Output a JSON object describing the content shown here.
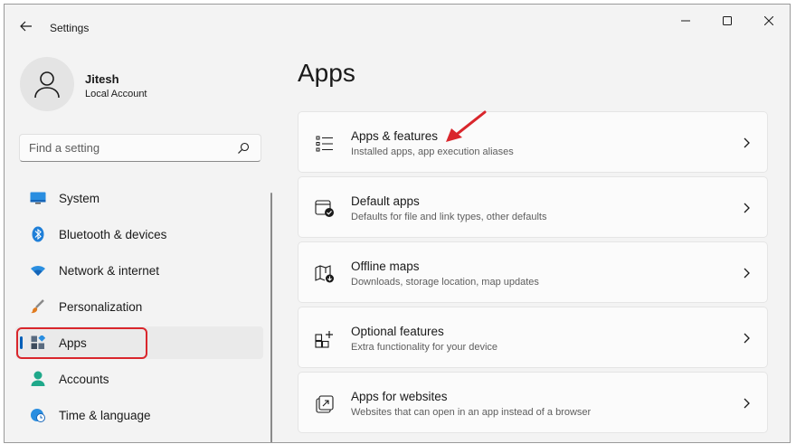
{
  "window": {
    "title": "Settings"
  },
  "account": {
    "name": "Jitesh",
    "type": "Local Account"
  },
  "search": {
    "placeholder": "Find a setting"
  },
  "nav": {
    "items": [
      {
        "label": "System",
        "icon": "monitor-icon"
      },
      {
        "label": "Bluetooth & devices",
        "icon": "bluetooth-icon"
      },
      {
        "label": "Network & internet",
        "icon": "wifi-icon"
      },
      {
        "label": "Personalization",
        "icon": "brush-icon"
      },
      {
        "label": "Apps",
        "icon": "apps-icon",
        "selected": true
      },
      {
        "label": "Accounts",
        "icon": "person-icon"
      },
      {
        "label": "Time & language",
        "icon": "globe-clock-icon"
      }
    ]
  },
  "main": {
    "title": "Apps",
    "cards": [
      {
        "title": "Apps & features",
        "description": "Installed apps, app execution aliases",
        "icon": "list-icon"
      },
      {
        "title": "Default apps",
        "description": "Defaults for file and link types, other defaults",
        "icon": "default-apps-icon"
      },
      {
        "title": "Offline maps",
        "description": "Downloads, storage location, map updates",
        "icon": "map-icon"
      },
      {
        "title": "Optional features",
        "description": "Extra functionality for your device",
        "icon": "add-feature-icon"
      },
      {
        "title": "Apps for websites",
        "description": "Websites that can open in an app instead of a browser",
        "icon": "open-link-icon"
      }
    ]
  },
  "colors": {
    "accent": "#005fb8",
    "annotation": "#d9262c"
  }
}
